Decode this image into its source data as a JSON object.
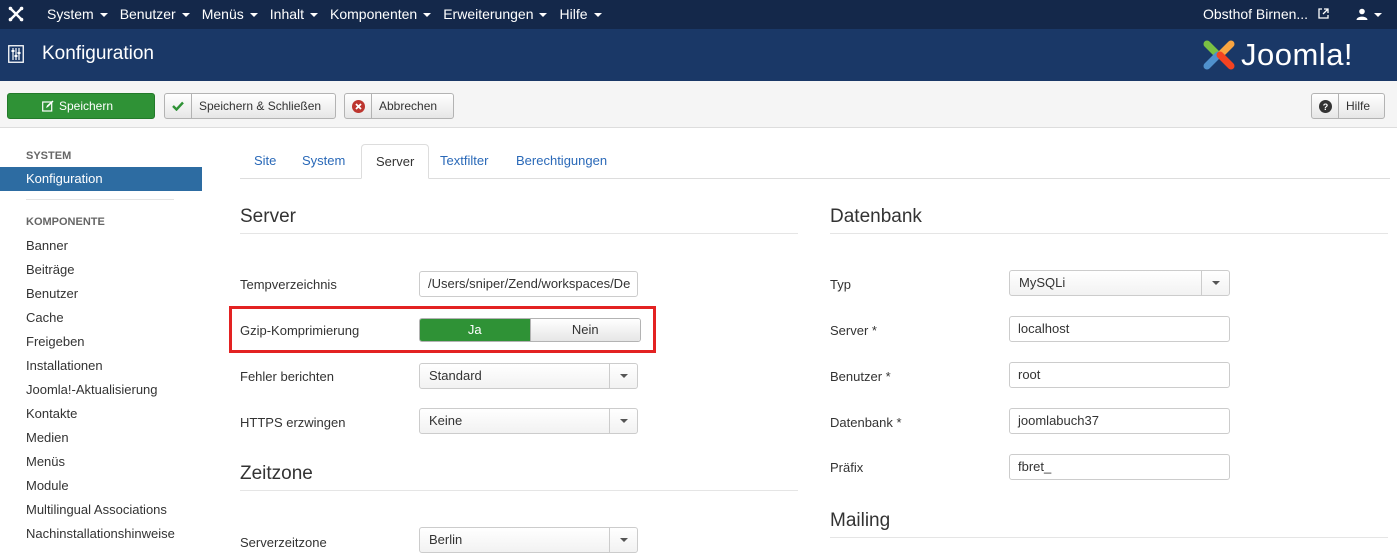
{
  "navbar": {
    "logo_icon": "joomla-x-icon",
    "menu": [
      {
        "label": "System"
      },
      {
        "label": "Benutzer"
      },
      {
        "label": "Menüs"
      },
      {
        "label": "Inhalt"
      },
      {
        "label": "Komponenten"
      },
      {
        "label": "Erweiterungen"
      },
      {
        "label": "Hilfe"
      }
    ],
    "site_name": "Obsthof Birnen...",
    "site_icon": "external-link-icon",
    "user_icon": "user-icon"
  },
  "header": {
    "title": "Konfiguration",
    "title_icon": "equalizer-icon",
    "brand": "Joomla!"
  },
  "toolbar": {
    "save_label": "Speichern",
    "save_close_label": "Speichern & Schließen",
    "cancel_label": "Abbrechen",
    "help_label": "Hilfe"
  },
  "sidebar": {
    "system_heading": "SYSTEM",
    "active_item": "Konfiguration",
    "component_heading": "KOMPONENTE",
    "items": [
      "Banner",
      "Beiträge",
      "Benutzer",
      "Cache",
      "Freigeben",
      "Installationen",
      "Joomla!-Aktualisierung",
      "Kontakte",
      "Medien",
      "Menüs",
      "Module",
      "Multilingual Associations",
      "Nachinstallationshinweise"
    ]
  },
  "tabs": [
    "Site",
    "System",
    "Server",
    "Textfilter",
    "Berechtigungen"
  ],
  "active_tab": "Server",
  "server": {
    "title": "Server",
    "temp_label": "Tempverzeichnis",
    "temp_value": "/Users/sniper/Zend/workspaces/De",
    "gzip_label": "Gzip-Komprimierung",
    "gzip_yes": "Ja",
    "gzip_no": "Nein",
    "gzip_selected": "Ja",
    "errors_label": "Fehler berichten",
    "errors_value": "Standard",
    "https_label": "HTTPS erzwingen",
    "https_value": "Keine"
  },
  "timezone": {
    "title": "Zeitzone",
    "server_tz_label": "Serverzeitzone",
    "server_tz_value": "Berlin"
  },
  "database": {
    "title": "Datenbank",
    "type_label": "Typ",
    "type_value": "MySQLi",
    "server_label": "Server *",
    "server_value": "localhost",
    "user_label": "Benutzer *",
    "user_value": "root",
    "db_label": "Datenbank *",
    "db_value": "joomlabuch37",
    "prefix_label": "Präfix",
    "prefix_value": "fbret_"
  },
  "mailing": {
    "title": "Mailing"
  },
  "colors": {
    "navbar": "#14284a",
    "header": "#1a3867",
    "save_green": "#2f9236",
    "sidebar_active": "#2d6ca2",
    "link_blue": "#2a69b8",
    "highlight_red": "#e32222"
  }
}
